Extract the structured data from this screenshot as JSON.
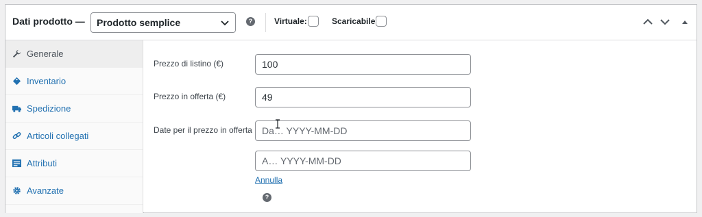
{
  "header": {
    "title": "Dati prodotto —",
    "product_type": "Prodotto semplice",
    "help_glyph": "?",
    "virtual_label": "Virtuale:",
    "downloadable_label": "Scaricabile:"
  },
  "sidebar": {
    "items": [
      {
        "label": "Generale",
        "icon": "wrench-icon"
      },
      {
        "label": "Inventario",
        "icon": "tag-icon"
      },
      {
        "label": "Spedizione",
        "icon": "truck-icon"
      },
      {
        "label": "Articoli collegati",
        "icon": "link-icon"
      },
      {
        "label": "Attributi",
        "icon": "list-icon"
      },
      {
        "label": "Avanzate",
        "icon": "gear-icon"
      }
    ]
  },
  "general": {
    "regular_price_label": "Prezzo di listino (€)",
    "regular_price_value": "100",
    "sale_price_label": "Prezzo in offerta (€)",
    "sale_price_value": "49",
    "sale_dates_label": "Date per il prezzo in offerta",
    "date_from_placeholder": "Da… YYYY-MM-DD",
    "date_to_placeholder": "A…  YYYY-MM-DD",
    "cancel_link": "Annulla",
    "help_glyph": "?"
  },
  "colors": {
    "accent": "#2271b1",
    "text": "#1d2327",
    "border": "#8c8f94"
  }
}
